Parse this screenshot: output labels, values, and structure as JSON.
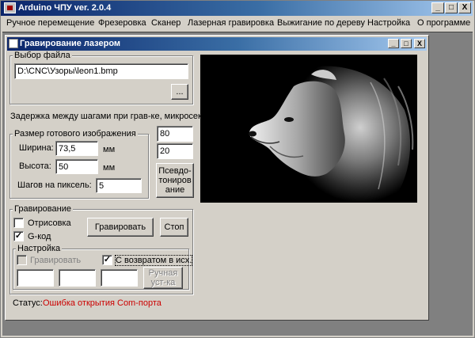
{
  "app": {
    "title": "Arduino ЧПУ   ver. 2.0.4",
    "controls": {
      "minimize": "_",
      "maximize": "□",
      "close": "X"
    }
  },
  "menu": [
    "Ручное перемещение",
    "Фрезеровка",
    "Сканер",
    "Лазерная гравировка",
    "Выжигание по дереву",
    "Настройка",
    "О программе"
  ],
  "child_window": {
    "title": "Гравирование лазером",
    "controls": {
      "minimize": "_",
      "maximize": "□",
      "close": "X"
    }
  },
  "file_group": {
    "legend": "Выбор файла",
    "path": "D:\\CNC\\Узоры\\leon1.bmp",
    "browse_label": "..."
  },
  "delay": {
    "label": "Задержка между шагами при грав-ке, микросек.",
    "value1": "80",
    "value2": "20"
  },
  "size_group": {
    "legend": "Размер готового изображения",
    "width_label": "Ширина:",
    "width_value": "73,5",
    "width_unit": "мм",
    "height_label": "Высота:",
    "height_value": "50",
    "height_unit": "мм",
    "steps_label": "Шагов на пиксель:",
    "steps_value": "5"
  },
  "pseudo_button": [
    "Псевдо-",
    "тониров",
    "ание"
  ],
  "engrave_group": {
    "legend": "Гравирование",
    "draw_label": "Отрисовка",
    "draw_checked": false,
    "gcode_label": "G-код",
    "gcode_checked": true,
    "engrave_button": "Гравировать",
    "stop_button": "Стоп"
  },
  "settings_group": {
    "legend": "Настройка",
    "engrave_check_label": "Гравировать",
    "engrave_check_checked": false,
    "return_check_label": "С возвратом в исх.",
    "return_check_checked": true,
    "field1": "",
    "field2": "",
    "field3": "",
    "manual_button": [
      "Ручная",
      "уст-ка"
    ]
  },
  "status": {
    "label": "Статус:",
    "text": "Ошибка открытия Com-порта",
    "color": "#cc0000"
  },
  "preview": {
    "description": "lion-photo"
  }
}
